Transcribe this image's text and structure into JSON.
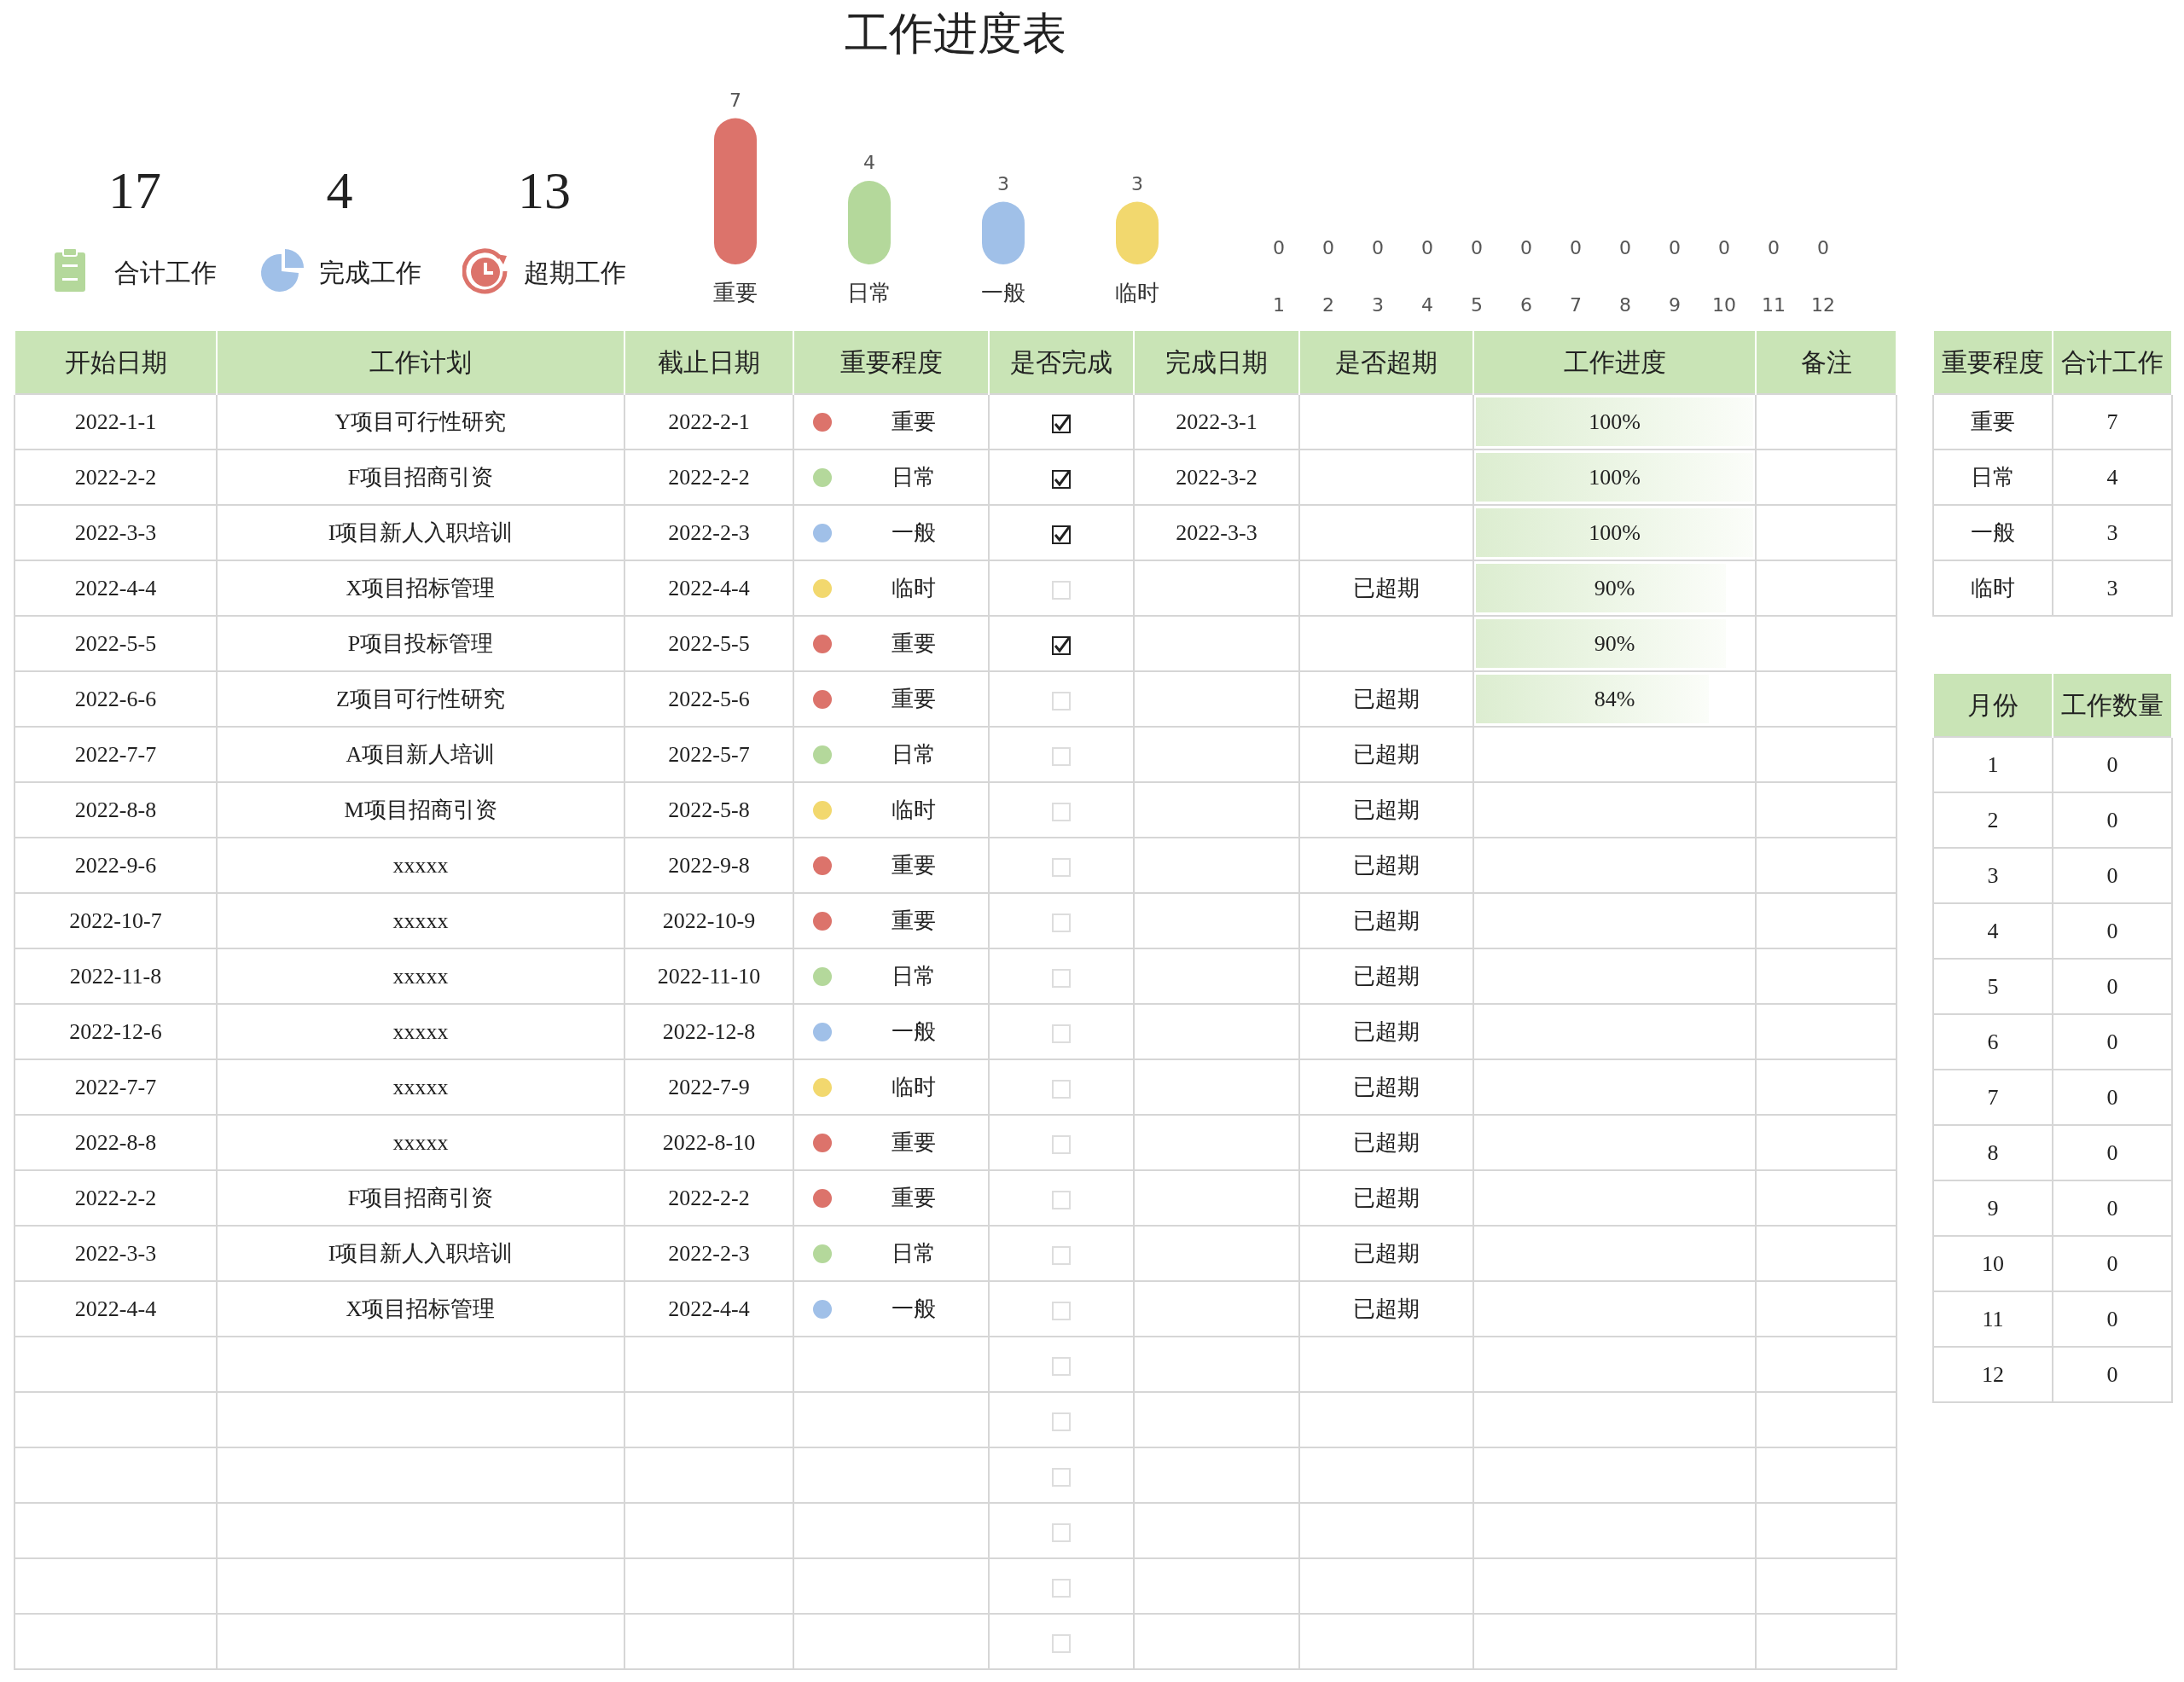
{
  "title": "工作进度表",
  "stats": [
    {
      "kind": "total",
      "value": "17",
      "label": "合计工作"
    },
    {
      "kind": "done",
      "value": "4",
      "label": "完成工作"
    },
    {
      "kind": "overdue",
      "value": "13",
      "label": "超期工作"
    }
  ],
  "importance_chart": {
    "chart_data": {
      "type": "bar",
      "categories": [
        "重要",
        "日常",
        "一般",
        "临时"
      ],
      "colors": [
        "#dc736b",
        "#b4d89b",
        "#a0c0e8",
        "#f2d86e"
      ],
      "values": [
        7,
        4,
        3,
        3
      ],
      "data_labels": true
    }
  },
  "month_counts": [
    {
      "count": "0",
      "month": "1"
    },
    {
      "count": "0",
      "month": "2"
    },
    {
      "count": "0",
      "month": "3"
    },
    {
      "count": "0",
      "month": "4"
    },
    {
      "count": "0",
      "month": "5"
    },
    {
      "count": "0",
      "month": "6"
    },
    {
      "count": "0",
      "month": "7"
    },
    {
      "count": "0",
      "month": "8"
    },
    {
      "count": "0",
      "month": "9"
    },
    {
      "count": "0",
      "month": "10"
    },
    {
      "count": "0",
      "month": "11"
    },
    {
      "count": "0",
      "month": "12"
    }
  ],
  "table": {
    "columns": [
      "开始日期",
      "工作计划",
      "截止日期",
      "重要程度",
      "是否完成",
      "完成日期",
      "是否超期",
      "工作进度",
      "备注"
    ],
    "rows": [
      {
        "start": "2022-1-1",
        "plan": "Y项目可行性研究",
        "deadline": "2022-2-1",
        "importance": "重要",
        "color": "#dc736b",
        "done": true,
        "done_date": "2022-3-1",
        "progress": "100%",
        "level": 1
      },
      {
        "start": "2022-2-2",
        "plan": "F项目招商引资",
        "deadline": "2022-2-2",
        "importance": "日常",
        "color": "#b4d89b",
        "done": true,
        "done_date": "2022-3-2",
        "progress": "100%",
        "level": 1
      },
      {
        "start": "2022-3-3",
        "plan": "I项目新人入职培训",
        "deadline": "2022-2-3",
        "importance": "一般",
        "color": "#a0c0e8",
        "done": true,
        "done_date": "2022-3-3",
        "progress": "100%",
        "level": 1
      },
      {
        "start": "2022-4-4",
        "plan": "X项目招标管理",
        "deadline": "2022-4-4",
        "importance": "临时",
        "color": "#f2d86e",
        "done": false,
        "overdue": "已超期",
        "progress": "90%",
        "level": 0.9
      },
      {
        "start": "2022-5-5",
        "plan": "P项目投标管理",
        "deadline": "2022-5-5",
        "importance": "重要",
        "color": "#dc736b",
        "done": true,
        "progress": "90%",
        "level": 0.9
      },
      {
        "start": "2022-6-6",
        "plan": "Z项目可行性研究",
        "deadline": "2022-5-6",
        "importance": "重要",
        "color": "#dc736b",
        "done": false,
        "overdue": "已超期",
        "progress": "84%",
        "level": 0.84
      },
      {
        "start": "2022-7-7",
        "plan": "A项目新人培训",
        "deadline": "2022-5-7",
        "importance": "日常",
        "color": "#b4d89b",
        "done": false,
        "overdue": "已超期"
      },
      {
        "start": "2022-8-8",
        "plan": "M项目招商引资",
        "deadline": "2022-5-8",
        "importance": "临时",
        "color": "#f2d86e",
        "done": false,
        "overdue": "已超期"
      },
      {
        "start": "2022-9-6",
        "plan": "xxxxx",
        "deadline": "2022-9-8",
        "importance": "重要",
        "color": "#dc736b",
        "done": false,
        "overdue": "已超期"
      },
      {
        "start": "2022-10-7",
        "plan": "xxxxx",
        "deadline": "2022-10-9",
        "importance": "重要",
        "color": "#dc736b",
        "done": false,
        "overdue": "已超期"
      },
      {
        "start": "2022-11-8",
        "plan": "xxxxx",
        "deadline": "2022-11-10",
        "importance": "日常",
        "color": "#b4d89b",
        "done": false,
        "overdue": "已超期"
      },
      {
        "start": "2022-12-6",
        "plan": "xxxxx",
        "deadline": "2022-12-8",
        "importance": "一般",
        "color": "#a0c0e8",
        "done": false,
        "overdue": "已超期"
      },
      {
        "start": "2022-7-7",
        "plan": "xxxxx",
        "deadline": "2022-7-9",
        "importance": "临时",
        "color": "#f2d86e",
        "done": false,
        "overdue": "已超期"
      },
      {
        "start": "2022-8-8",
        "plan": "xxxxx",
        "deadline": "2022-8-10",
        "importance": "重要",
        "color": "#dc736b",
        "done": false,
        "overdue": "已超期"
      },
      {
        "start": "2022-2-2",
        "plan": "F项目招商引资",
        "deadline": "2022-2-2",
        "importance": "重要",
        "color": "#dc736b",
        "done": false,
        "overdue": "已超期"
      },
      {
        "start": "2022-3-3",
        "plan": "I项目新人入职培训",
        "deadline": "2022-2-3",
        "importance": "日常",
        "color": "#b4d89b",
        "done": false,
        "overdue": "已超期"
      },
      {
        "start": "2022-4-4",
        "plan": "X项目招标管理",
        "deadline": "2022-4-4",
        "importance": "一般",
        "color": "#a0c0e8",
        "done": false,
        "overdue": "已超期"
      },
      {
        "done": false
      },
      {
        "done": false
      },
      {
        "done": false
      },
      {
        "done": false
      },
      {
        "done": false
      },
      {
        "done": false
      }
    ]
  },
  "importance_summary": {
    "columns": [
      "重要程度",
      "合计工作"
    ],
    "rows": [
      [
        "重要",
        "7"
      ],
      [
        "日常",
        "4"
      ],
      [
        "一般",
        "3"
      ],
      [
        "临时",
        "3"
      ]
    ]
  },
  "month_summary": {
    "columns": [
      "月份",
      "工作数量"
    ],
    "rows": [
      [
        "1",
        "0"
      ],
      [
        "2",
        "0"
      ],
      [
        "3",
        "0"
      ],
      [
        "4",
        "0"
      ],
      [
        "5",
        "0"
      ],
      [
        "6",
        "0"
      ],
      [
        "7",
        "0"
      ],
      [
        "8",
        "0"
      ],
      [
        "9",
        "0"
      ],
      [
        "10",
        "0"
      ],
      [
        "11",
        "0"
      ],
      [
        "12",
        "0"
      ]
    ]
  }
}
